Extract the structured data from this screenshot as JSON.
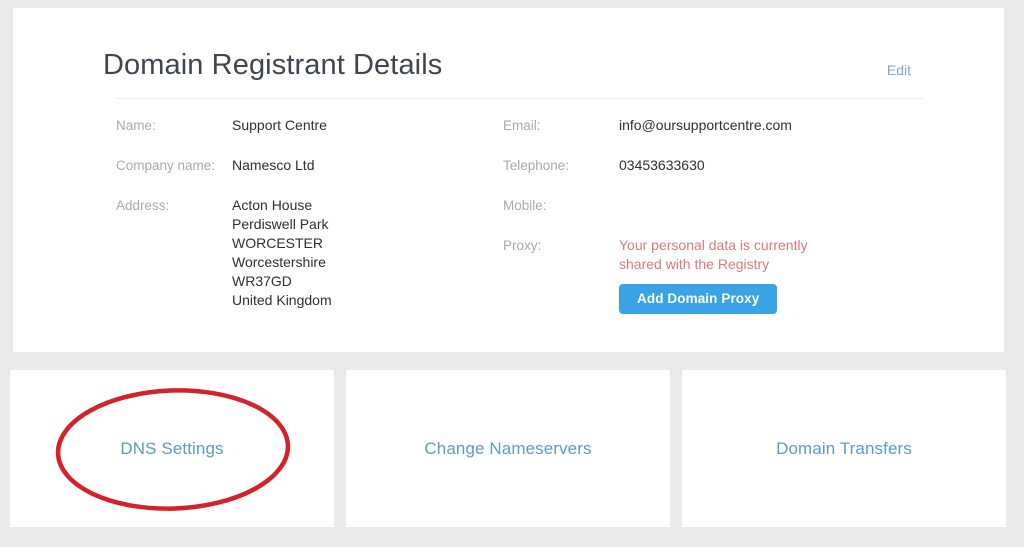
{
  "panel": {
    "title": "Domain Registrant Details",
    "edit_label": "Edit"
  },
  "registrant": {
    "left_fields": [
      {
        "label": "Name:",
        "value": "Support Centre"
      },
      {
        "label": "Company name:",
        "value": "Namesco Ltd"
      }
    ],
    "address": {
      "label": "Address:",
      "lines": [
        "Acton House",
        "Perdiswell Park",
        "WORCESTER",
        "Worcestershire",
        "WR37GD",
        "United Kingdom"
      ]
    },
    "right_fields": [
      {
        "label": "Email:",
        "value": "info@oursupportcentre.com"
      },
      {
        "label": "Telephone:",
        "value": "03453633630"
      },
      {
        "label": "Mobile:",
        "value": ""
      }
    ],
    "proxy": {
      "label": "Proxy:",
      "status_line_1": "Your personal data is currently",
      "status_line_2": "shared with the Registry",
      "button_label": "Add Domain Proxy"
    }
  },
  "action_cards": [
    {
      "label": "DNS Settings"
    },
    {
      "label": "Change Nameservers"
    },
    {
      "label": "Domain Transfers"
    }
  ],
  "annotation": {
    "shape": "red-ellipse-highlight",
    "target": "DNS Settings"
  },
  "colors": {
    "page_background": "#eaeaea",
    "panel_background": "#ffffff",
    "title_text": "#3f4650",
    "label_text": "#a9a9ad",
    "value_text": "#2f2f31",
    "link_blue": "#5d9cc0",
    "edit_link": "#7fa8c4",
    "button_blue": "#3aa3e3",
    "warning_red": "#e0787a",
    "annotation_red": "#d6202a"
  }
}
